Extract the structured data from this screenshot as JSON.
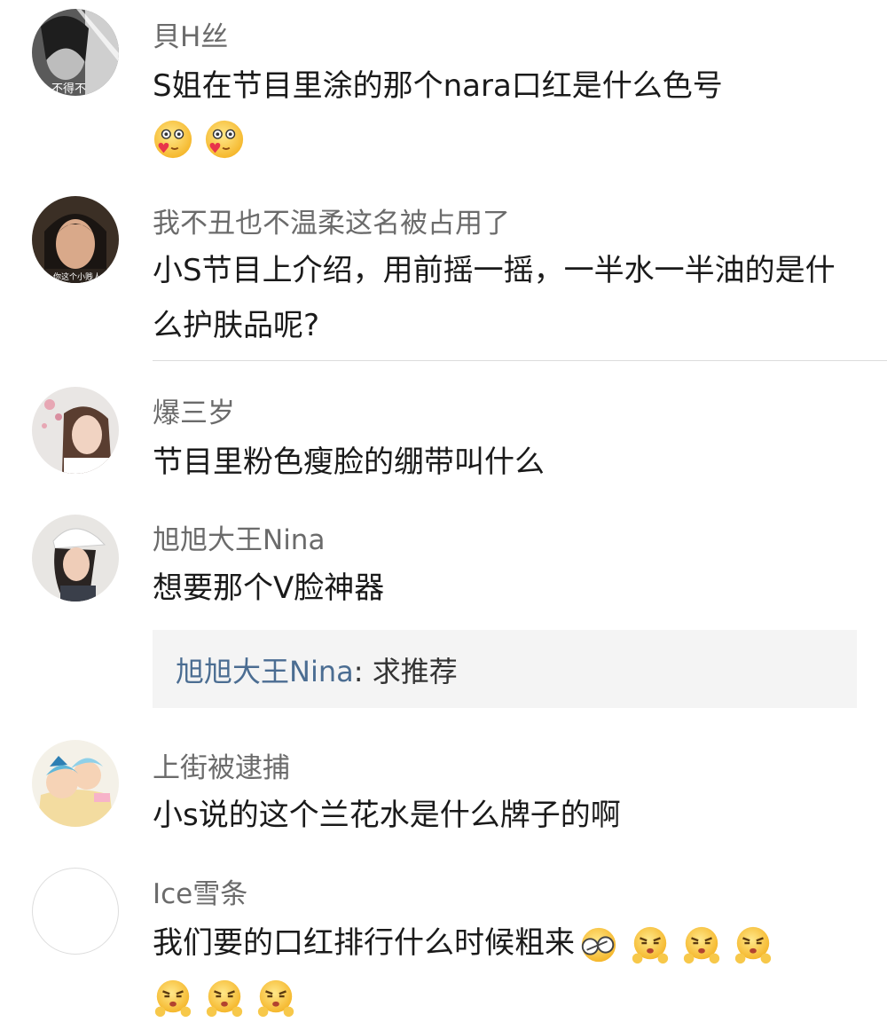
{
  "comments": [
    {
      "username": "貝H丝",
      "text": "S姐在节目里涂的那个nara口红是什么色号",
      "emojis": [
        "love-face-emoji",
        "love-face-emoji"
      ]
    },
    {
      "username": "我不丑也不温柔这名被占用了",
      "text": "小S节目上介绍，用前摇一摇，一半水一半油的是什么护肤品呢?"
    },
    {
      "username": "爆三岁",
      "text": "节目里粉色瘦脸的绷带叫什么"
    },
    {
      "username": "旭旭大王Nina",
      "text": "想要那个V脸神器",
      "reply": {
        "user": "旭旭大王Nina",
        "separator": ": ",
        "text": "求推荐"
      }
    },
    {
      "username": "上街被逮捕",
      "text": "小s说的这个兰花水是什么牌子的啊"
    },
    {
      "username": "Ice雪条",
      "text": "我们要的口红排行什么时候粗来",
      "emojis": [
        "covering-eyes-emoji",
        "pouting-emoji",
        "pouting-emoji",
        "pouting-emoji",
        "pouting-emoji",
        "pouting-emoji",
        "pouting-emoji"
      ]
    }
  ],
  "avatar_labels": {
    "a1": "不得不",
    "a2": "你这个小贱人"
  },
  "colors": {
    "background": "#ffffff",
    "username": "#6b6b6b",
    "text": "#1a1a1a",
    "reply_user": "#4b6d92",
    "reply_bg": "#f4f4f4",
    "divider": "#dcdcdc"
  }
}
